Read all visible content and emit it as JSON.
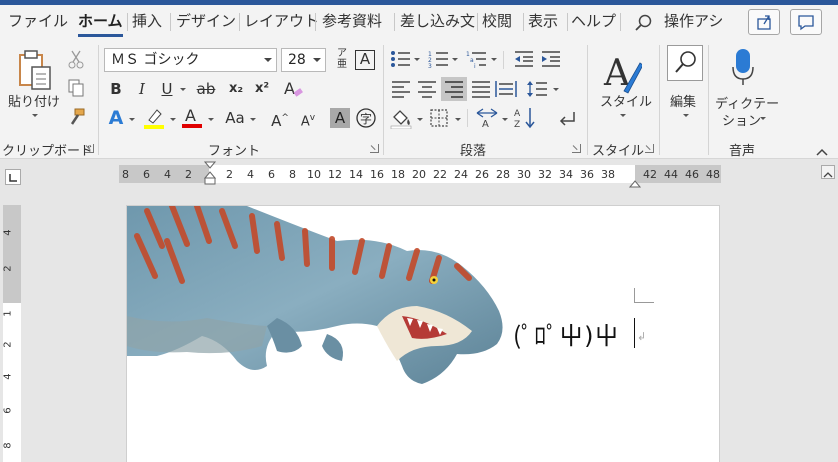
{
  "tabs": [
    {
      "label": "ファイル"
    },
    {
      "label": "ホーム",
      "active": true
    },
    {
      "label": "挿入"
    },
    {
      "label": "デザイン"
    },
    {
      "label": "レイアウト"
    },
    {
      "label": "参考資料"
    },
    {
      "label": "差し込み文"
    },
    {
      "label": "校閲"
    },
    {
      "label": "表示"
    },
    {
      "label": "ヘルプ"
    }
  ],
  "search_label": "操作アシ",
  "clipboard": {
    "paste_label": "貼り付け",
    "group_label": "クリップボード"
  },
  "font": {
    "name": "ＭＳ ゴシック",
    "size": "28",
    "group_label": "フォント",
    "bold": "B",
    "italic": "I",
    "underline": "U",
    "strike": "ab",
    "subscript": "x₂",
    "superscript": "x²",
    "case": "Aa",
    "grow": "A",
    "shrink": "A",
    "highlight_color": "#ffff00",
    "font_color": "#e00000"
  },
  "paragraph": {
    "group_label": "段落"
  },
  "styles": {
    "label": "スタイル",
    "group_label": "スタイル"
  },
  "editing": {
    "label": "編集"
  },
  "voice": {
    "label1": "ディクテー",
    "label2": "ション",
    "group_label": "音声"
  },
  "ruler": {
    "left_ticks": [
      "8",
      "6",
      "4",
      "2"
    ],
    "right_ticks": [
      "2",
      "4",
      "6",
      "8",
      "10",
      "12",
      "14",
      "16",
      "18",
      "20",
      "22",
      "24",
      "26",
      "28",
      "30",
      "32",
      "34",
      "36",
      "38"
    ],
    "end_ticks": [
      "42",
      "44",
      "46",
      "48"
    ],
    "vertical_ticks": [
      "4",
      "2",
      "1",
      "2",
      "4",
      "6",
      "8"
    ]
  },
  "document": {
    "text": "(ﾟﾛﾟ屮)屮",
    "image_subject": "T-rex dinosaur",
    "paragraph_mark": "↲"
  },
  "colors": {
    "accent": "#2b579a",
    "ribbon_bg": "#f3f3f3",
    "canvas_bg": "#e6e6e6"
  }
}
